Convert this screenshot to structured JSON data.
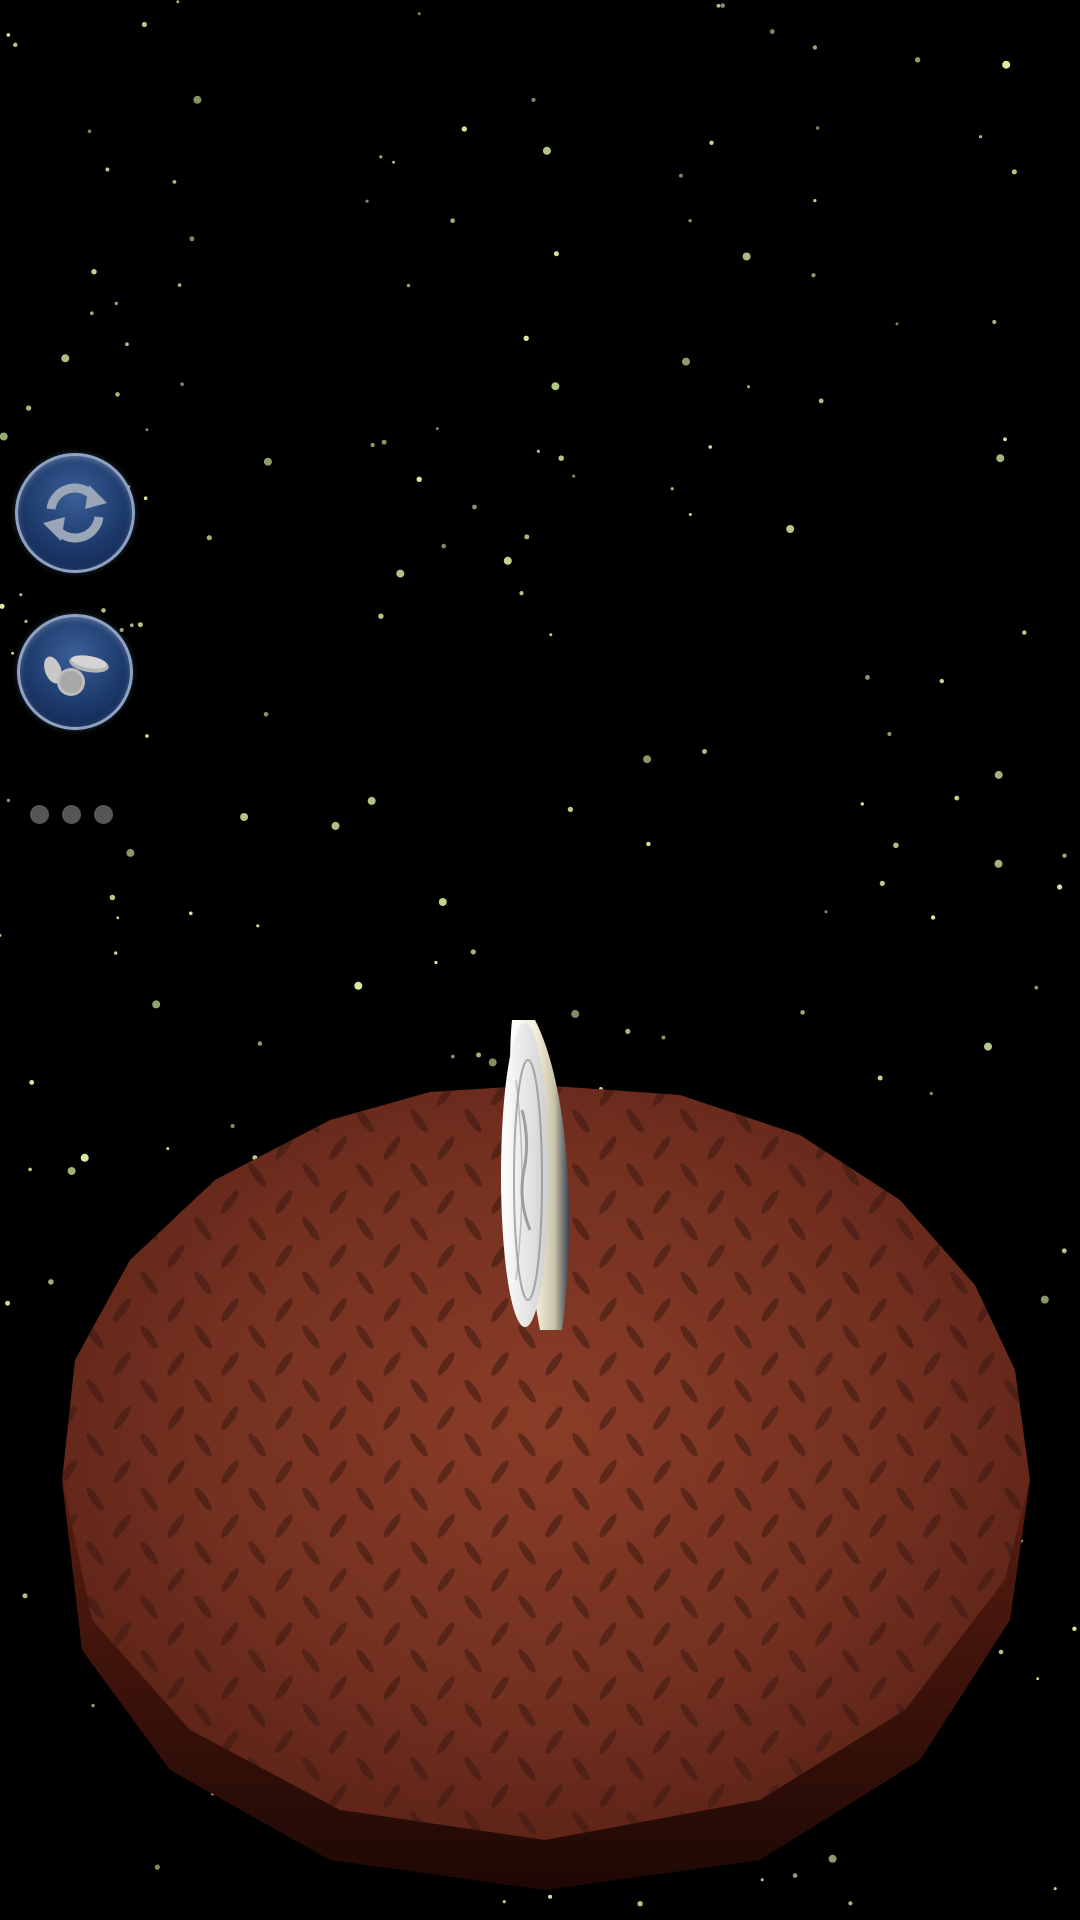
{
  "scene": {
    "background_color": "#000000",
    "star_color": "#d8f0a0",
    "platform_color": "#7a3322",
    "platform_edge_color": "#4a160c",
    "coin_color": "#e8e8e8"
  },
  "controls": {
    "reset_button": {
      "icon": "refresh-icon",
      "accent_color": "#1d3a6c"
    },
    "coin_select_button": {
      "icon": "coins-icon",
      "accent_color": "#1d3a6c"
    },
    "more_menu": {
      "icon": "more-dots-icon",
      "dot_color": "#555555"
    }
  }
}
